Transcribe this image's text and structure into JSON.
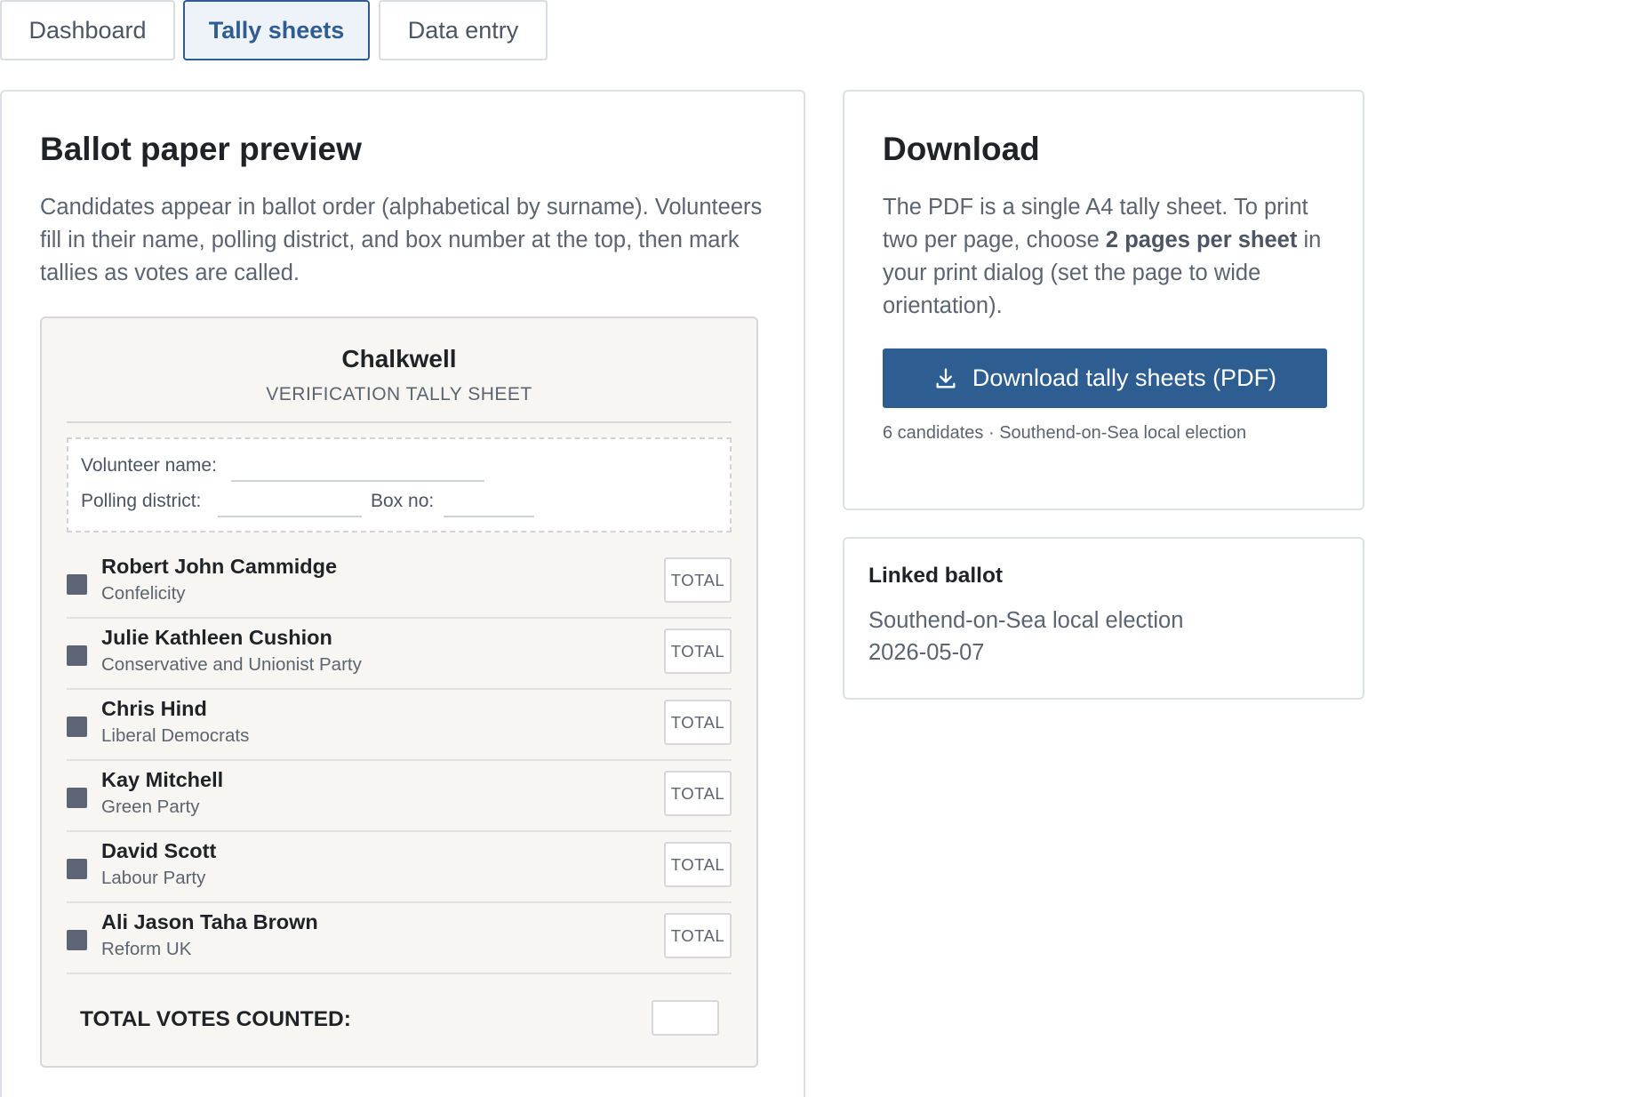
{
  "tabs": [
    {
      "label": "Dashboard",
      "active": false
    },
    {
      "label": "Tally sheets",
      "active": true
    },
    {
      "label": "Data entry",
      "active": false
    }
  ],
  "preview": {
    "title": "Ballot paper preview",
    "description": "Candidates appear in ballot order (alphabetical by surname). Volunteers fill in their name, polling district, and box number at the top, then mark tallies as votes are called.",
    "sheet": {
      "title": "Chalkwell",
      "subtitle": "VERIFICATION TALLY SHEET",
      "volunteer_label": "Volunteer name:",
      "district_label": "Polling district:",
      "box_label": "Box no:",
      "total_label": "TOTAL",
      "grand_total_label": "TOTAL VOTES COUNTED:",
      "candidates": [
        {
          "name": "Robert John Cammidge",
          "party": "Confelicity"
        },
        {
          "name": "Julie Kathleen Cushion",
          "party": "Conservative and Unionist Party"
        },
        {
          "name": "Chris Hind",
          "party": "Liberal Democrats"
        },
        {
          "name": "Kay Mitchell",
          "party": "Green Party"
        },
        {
          "name": "David Scott",
          "party": "Labour Party"
        },
        {
          "name": "Ali Jason Taha Brown",
          "party": "Reform UK"
        }
      ]
    }
  },
  "download": {
    "title": "Download",
    "desc_part1": "The PDF is a single A4 tally sheet. To print two per page, choose ",
    "desc_bold": "2 pages per sheet",
    "desc_part2": " in your print dialog (set the page to wide orientation).",
    "button_label": "Download tally sheets (PDF)",
    "meta": "6 candidates · Southend-on-Sea local election"
  },
  "linked": {
    "title": "Linked ballot",
    "election": "Southend-on-Sea local election",
    "date": "2026-05-07"
  },
  "colors": {
    "accent": "#2e5d92",
    "swatch": "#5d6575",
    "sheet_bg": "#f7f6f2"
  }
}
